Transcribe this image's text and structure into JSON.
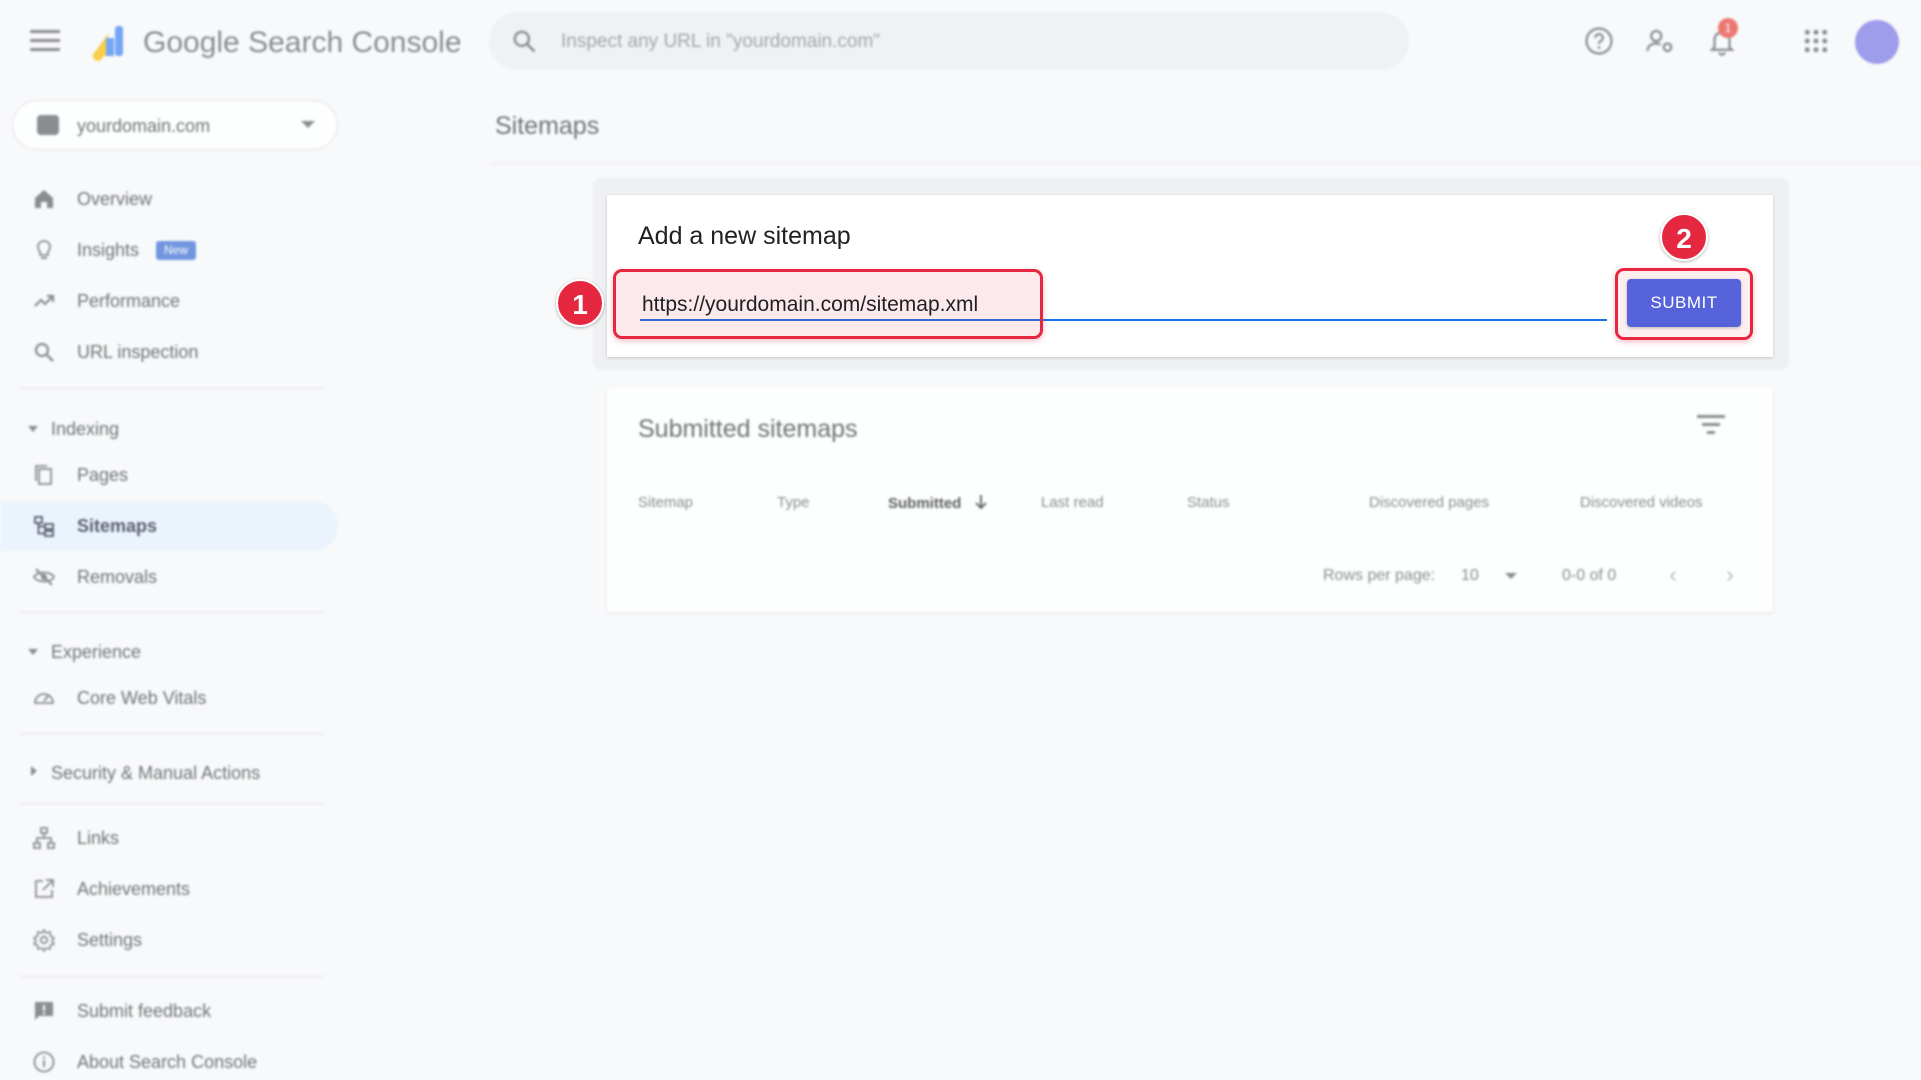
{
  "app": {
    "brand": "Google Search Console",
    "search_placeholder": "Inspect any URL in \"yourdomain.com\"",
    "notification_count": "1"
  },
  "sidebar": {
    "property": "yourdomain.com",
    "items_top": [
      {
        "label": "Overview",
        "icon": "home-icon"
      },
      {
        "label": "Insights",
        "icon": "lightbulb-icon",
        "badge": "New"
      },
      {
        "label": "Performance",
        "icon": "trending-up-icon"
      },
      {
        "label": "URL inspection",
        "icon": "search-icon"
      }
    ],
    "sections": {
      "indexing": "Indexing",
      "experience": "Experience",
      "security": "Security & Manual Actions"
    },
    "indexing_items": [
      {
        "label": "Pages",
        "icon": "pages-icon"
      },
      {
        "label": "Sitemaps",
        "icon": "sitemap-icon",
        "active": true
      },
      {
        "label": "Removals",
        "icon": "eye-off-icon"
      }
    ],
    "experience_items": [
      {
        "label": "Core Web Vitals",
        "icon": "speedometer-icon"
      }
    ],
    "other_items": [
      {
        "label": "Links",
        "icon": "links-icon"
      },
      {
        "label": "Achievements",
        "icon": "external-link-icon"
      },
      {
        "label": "Settings",
        "icon": "gear-icon"
      }
    ],
    "footer_items": [
      {
        "label": "Submit feedback",
        "icon": "feedback-icon"
      },
      {
        "label": "About Search Console",
        "icon": "info-icon"
      }
    ]
  },
  "main": {
    "page_title": "Sitemaps",
    "add_sitemap": {
      "title": "Add a new sitemap",
      "url_value": "https://yourdomain.com/sitemap.xml",
      "submit_label": "SUBMIT",
      "step1": "1",
      "step2": "2"
    },
    "submitted": {
      "title": "Submitted sitemaps",
      "columns": [
        "Sitemap",
        "Type",
        "Submitted",
        "Last read",
        "Status",
        "Discovered pages",
        "Discovered videos"
      ],
      "sorted_column": "Submitted",
      "rows_per_page_label": "Rows per page:",
      "rows_per_page_value": "10",
      "range": "0-0 of 0"
    }
  },
  "colors": {
    "highlight": "#e52740",
    "submit": "#5662d9",
    "active_nav": "#e6f1fd",
    "avatar": "#7b78e6"
  }
}
